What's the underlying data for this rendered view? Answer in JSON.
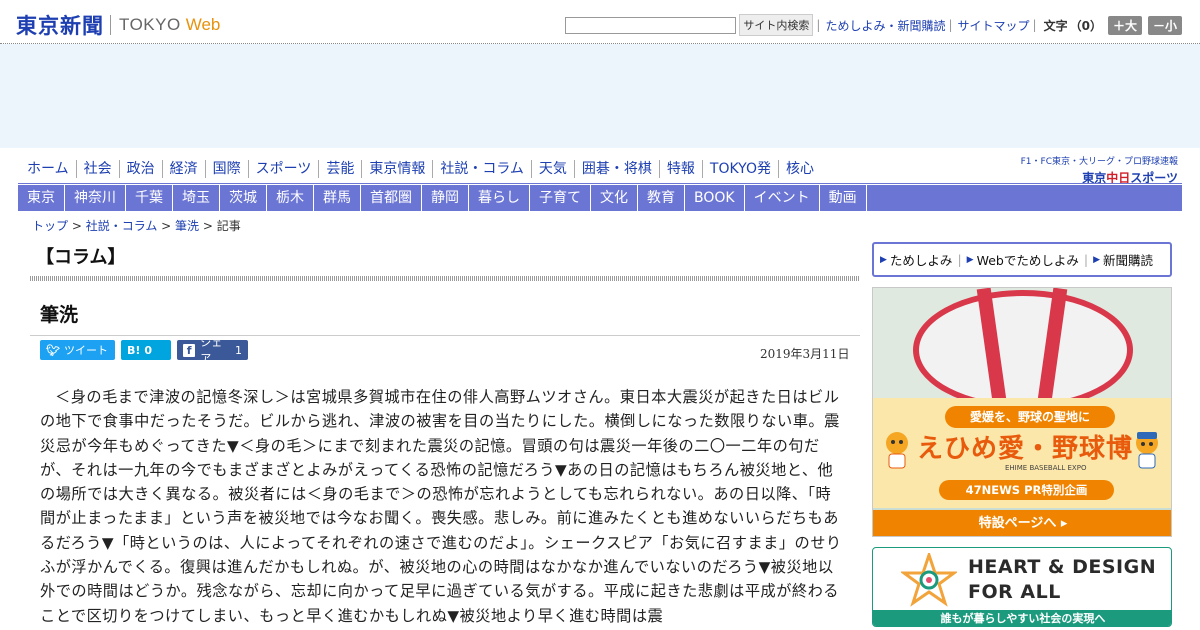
{
  "header": {
    "logo_jp": "東京新聞",
    "logo_en": "TOKYO",
    "logo_web": "Web",
    "search_placeholder": "",
    "search_button": "サイト内検索",
    "links": [
      "ためしよみ・新聞購読",
      "サイトマップ"
    ],
    "text_size_label": "文字",
    "text_size_count": "（0）",
    "enlarge_button": "＋大",
    "shrink_button": "－小"
  },
  "main_nav": [
    "ホーム",
    "社会",
    "政治",
    "経済",
    "国際",
    "スポーツ",
    "芸能",
    "東京情報",
    "社説・コラム",
    "天気",
    "囲碁・将棋",
    "特報",
    "TOKYO発",
    "核心"
  ],
  "chunichi_banner": {
    "sub": "F1・FC東京・大リーグ・プロ野球速報",
    "prefix": "東京",
    "red": "中日",
    "suffix": "スポーツ"
  },
  "region_nav": [
    "東京",
    "神奈川",
    "千葉",
    "埼玉",
    "茨城",
    "栃木",
    "群馬",
    "首都圏",
    "静岡",
    "暮らし",
    "子育て",
    "文化",
    "教育",
    "BOOK",
    "イベント",
    "動画"
  ],
  "breadcrumb": {
    "items": [
      "トップ",
      "社説・コラム",
      "筆洗"
    ],
    "separator": " > ",
    "current": "記事"
  },
  "section_title": "【コラム】",
  "article": {
    "title": "筆洗",
    "date": "2019年3月11日",
    "share": {
      "tweet": "ツイート",
      "hatena_glyph": "B!",
      "hatena_count": "0",
      "fb_label": "シェア",
      "fb_count": "1"
    },
    "body": "＜身の毛まで津波の記憶冬深し＞は宮城県多賀城市在住の俳人高野ムツオさん。東日本大震災が起きた日はビルの地下で食事中だったそうだ。ビルから逃れ、津波の被害を目の当たりにした。横倒しになった数限りない車。震災忌が今年もめぐってきた▼＜身の毛＞にまで刻まれた震災の記憶。冒頭の句は震災一年後の二〇一二年の句だが、それは一九年の今でもまざまざとよみがえってくる恐怖の記憶だろう▼あの日の記憶はもちろん被災地と、他の場所では大きく異なる。被災者には＜身の毛まで＞の恐怖が忘れようとしても忘れられない。あの日以降、「時間が止まったまま」という声を被災地では今なお聞く。喪失感。悲しみ。前に進みたくとも進めないいらだちもあるだろう▼「時というのは、人によってそれぞれの速さで進むのだよ」。シェークスピア「お気に召すまま」のせりふが浮かんでくる。復興は進んだかもしれぬ。が、被災地の心の時間はなかなか進んでいないのだろう▼被災地以外での時間はどうか。残念ながら、忘却に向かって足早に過ぎている気がする。平成に起きた悲劇は平成が終わることで区切りをつけてしまい、もっと早く進むかもしれぬ▼被災地より早く進む時間は震"
  },
  "sidebar": {
    "links": [
      "ためしよみ",
      "Webでためしよみ",
      "新聞購読"
    ],
    "ad1": {
      "tagline": "愛媛を、野球の聖地に",
      "headline": "えひめ愛・野球博",
      "subline": "EHIME BASEBALL EXPO",
      "pr": "47NEWS PR特別企画",
      "cta": "特設ページへ ▸"
    },
    "ad2": {
      "line1": "HEART & DESIGN",
      "line2": "FOR ALL",
      "footer": "誰もが暮らしやすい社会の実現へ"
    }
  },
  "colors": {
    "brand_blue": "#1d3fb1",
    "nav_bar": "#6b76d4",
    "web_orange": "#e8920d",
    "ad_orange": "#f08400",
    "ad2_green": "#1b9a7e"
  }
}
